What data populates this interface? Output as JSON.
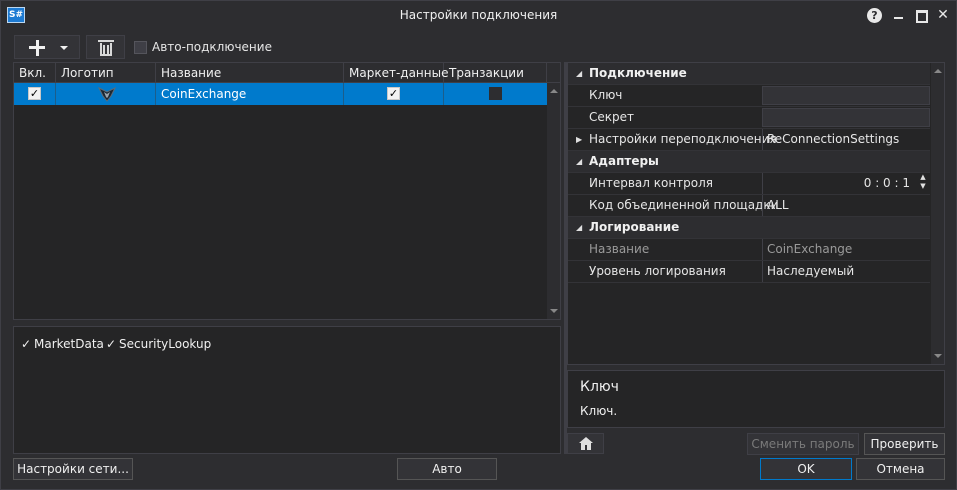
{
  "window": {
    "app_icon": "S#",
    "title": "Настройки подключения",
    "help_icon": "?",
    "close_glyph": "✕"
  },
  "toolbar": {
    "auto_connect_label": "Авто-подключение",
    "auto_connect_checked": false
  },
  "grid": {
    "columns": [
      "Вкл.",
      "Логотип",
      "Название",
      "Маркет-данные",
      "Транзакции"
    ],
    "rows": [
      {
        "enabled": true,
        "logo": "coinexchange-logo-icon",
        "name": "CoinExchange",
        "market_data": true,
        "transactions": false
      }
    ]
  },
  "capabilities": [
    {
      "label": "MarketData",
      "checked": true
    },
    {
      "label": "SecurityLookup",
      "checked": true
    }
  ],
  "properties": {
    "cat_connection": "Подключение",
    "key_label": "Ключ",
    "key_value": "",
    "secret_label": "Секрет",
    "secret_value": "",
    "reconnect_label": "Настройки переподключения",
    "reconnect_value": "ReConnectionSettings",
    "cat_adapters": "Адаптеры",
    "interval_label": "Интервал контроля",
    "interval_value": "0 : 0 : 1",
    "board_label": "Код объединенной площадки",
    "board_value": "ALL",
    "cat_logging": "Логирование",
    "log_name_label": "Название",
    "log_name_value": "CoinExchange",
    "log_level_label": "Уровень логирования",
    "log_level_value": "Наследуемый"
  },
  "description": {
    "title": "Ключ",
    "text": "Ключ."
  },
  "buttons": {
    "change_password": "Сменить пароль",
    "check": "Проверить",
    "network_settings": "Настройки сети...",
    "auto": "Авто",
    "ok": "OK",
    "cancel": "Отмена"
  },
  "colors": {
    "background": "#2d2d30",
    "selection": "#007acc",
    "panel": "#252526"
  }
}
